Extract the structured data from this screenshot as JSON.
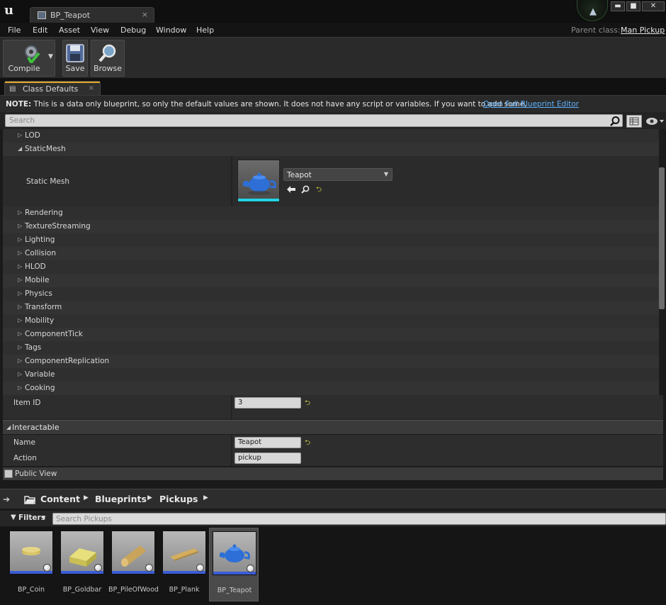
{
  "titlebar": {
    "tab_title": "BP_Teapot",
    "tab_close": "×",
    "win_min": "▬",
    "win_max": "■",
    "win_close": "✕"
  },
  "menu": {
    "items": [
      "File",
      "Edit",
      "Asset",
      "View",
      "Debug",
      "Window",
      "Help"
    ],
    "parent_class_label": "Parent class:",
    "parent_class_value": "Man Pickup"
  },
  "toolbar": {
    "compile_label": "Compile",
    "save_label": "Save",
    "browse_label": "Browse"
  },
  "panel_tab": {
    "label": "Class Defaults",
    "close": "×"
  },
  "note": {
    "prefix": "NOTE:",
    "text": " This is a data only blueprint, so only the default values are shown.  It does not have any script or variables.  If you want to add some,",
    "link": "Open Full Blueprint Editor"
  },
  "details": {
    "search_placeholder": "Search",
    "categories_top": [
      "LOD",
      "StaticMesh"
    ],
    "static_mesh": {
      "label": "Static Mesh",
      "value": "Teapot"
    },
    "categories": [
      "Rendering",
      "TextureStreaming",
      "Lighting",
      "Collision",
      "HLOD",
      "Mobile",
      "Physics",
      "Transform",
      "Mobility",
      "ComponentTick",
      "Tags",
      "ComponentReplication",
      "Variable",
      "Cooking"
    ],
    "item_id": {
      "label": "Item ID",
      "value": "3"
    },
    "interactable": {
      "label": "Interactable",
      "name": {
        "label": "Name",
        "value": "Teapot"
      },
      "action": {
        "label": "Action",
        "value": "pickup"
      }
    },
    "public_view": "Public View"
  },
  "content_browser": {
    "breadcrumb": [
      "Content",
      "Blueprints",
      "Pickups"
    ],
    "filters_label": "Filters",
    "search_placeholder": "Search Pickups",
    "assets": [
      {
        "name": "BP_Coin",
        "selected": false
      },
      {
        "name": "BP_Goldbar",
        "selected": false
      },
      {
        "name": "BP_PileOfWood",
        "selected": false
      },
      {
        "name": "BP_Plank",
        "selected": false
      },
      {
        "name": "BP_Teapot",
        "selected": true
      }
    ]
  },
  "colors": {
    "accent_link": "#5fb3ff",
    "reset_arrow": "#d9d64b",
    "tab_highlight": "#e3a82a",
    "asset_bar": "#3a5cd6"
  }
}
